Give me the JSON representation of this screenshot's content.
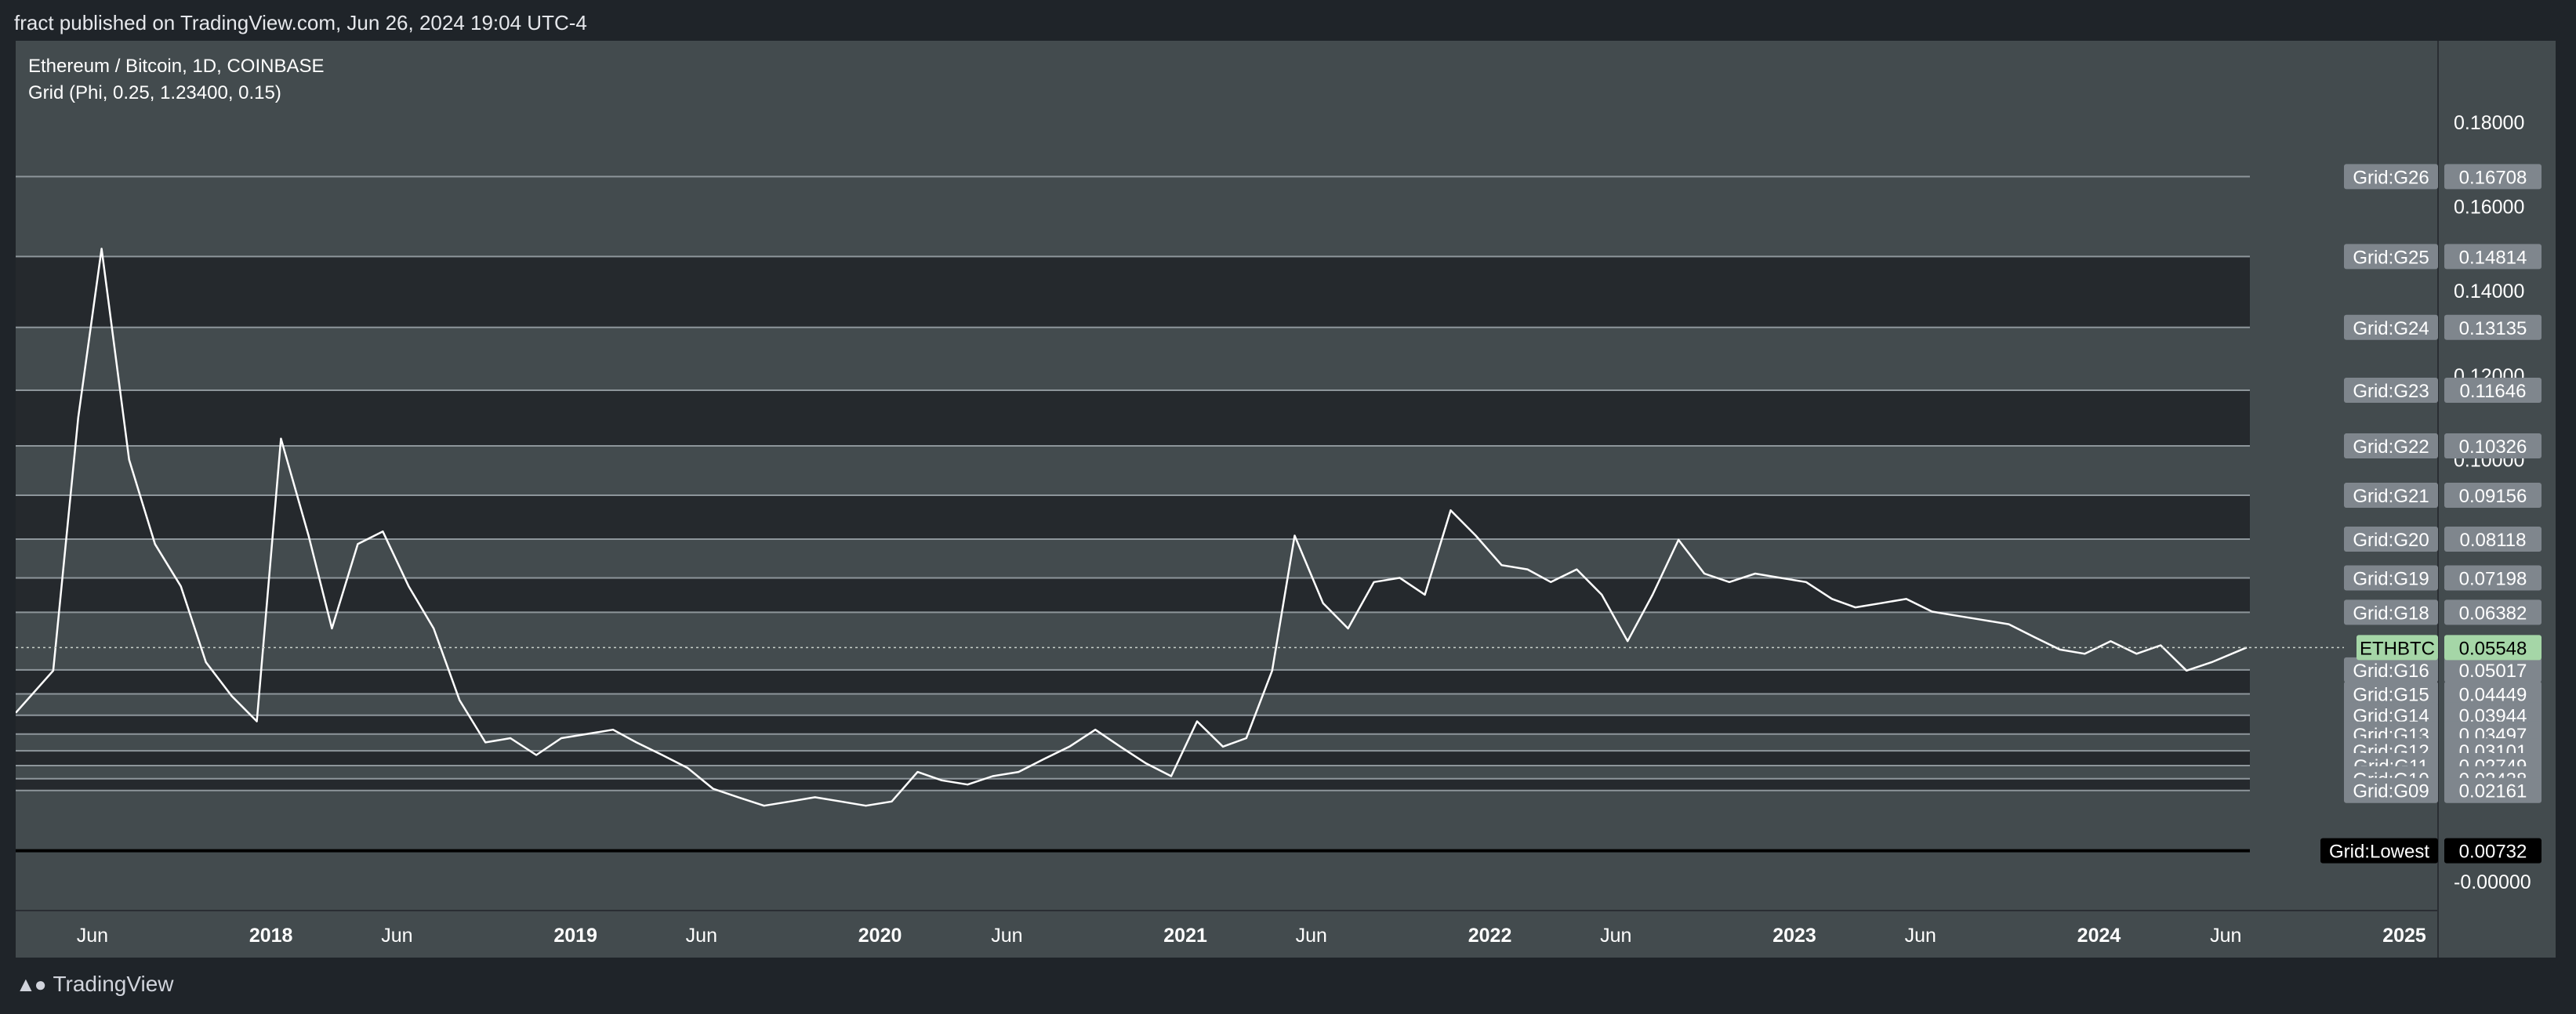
{
  "header": {
    "published": "fract published on TradingView.com, Jun 26, 2024 19:04 UTC-4"
  },
  "legend": {
    "symbol": "Ethereum / Bitcoin, 1D, COINBASE",
    "indicator": "Grid (Phi, 0.25, 1.23400, 0.15)"
  },
  "footer": {
    "brand": "TradingView",
    "logo_icon": "tradingview-logo-icon"
  },
  "chart_data": {
    "type": "line",
    "ylim": [
      -0.005,
      0.19
    ],
    "xlim": [
      "2017-03-01",
      "2025-02-01"
    ],
    "y_ticks": [
      "0.18000",
      "0.16000",
      "0.14000",
      "0.12000",
      "0.10000",
      "-0.00000"
    ],
    "y_tick_values": [
      0.18,
      0.16,
      0.14,
      0.12,
      0.1,
      0.0
    ],
    "x_ticks": [
      {
        "label": "Jun",
        "date": "2017-06-01",
        "bold": false
      },
      {
        "label": "2018",
        "date": "2018-01-01",
        "bold": true
      },
      {
        "label": "Jun",
        "date": "2018-06-01",
        "bold": false
      },
      {
        "label": "2019",
        "date": "2019-01-01",
        "bold": true
      },
      {
        "label": "Jun",
        "date": "2019-06-01",
        "bold": false
      },
      {
        "label": "2020",
        "date": "2020-01-01",
        "bold": true
      },
      {
        "label": "Jun",
        "date": "2020-06-01",
        "bold": false
      },
      {
        "label": "2021",
        "date": "2021-01-01",
        "bold": true
      },
      {
        "label": "Jun",
        "date": "2021-06-01",
        "bold": false
      },
      {
        "label": "2022",
        "date": "2022-01-01",
        "bold": true
      },
      {
        "label": "Jun",
        "date": "2022-06-01",
        "bold": false
      },
      {
        "label": "2023",
        "date": "2023-01-01",
        "bold": true
      },
      {
        "label": "Jun",
        "date": "2023-06-01",
        "bold": false
      },
      {
        "label": "2024",
        "date": "2024-01-01",
        "bold": true
      },
      {
        "label": "Jun",
        "date": "2024-06-01",
        "bold": false
      },
      {
        "label": "2025",
        "date": "2025-01-01",
        "bold": true
      }
    ],
    "series": [
      {
        "name": "ETHBTC",
        "x": [
          "2017-03-01",
          "2017-04-15",
          "2017-05-15",
          "2017-06-12",
          "2017-07-15",
          "2017-08-15",
          "2017-09-15",
          "2017-10-15",
          "2017-11-15",
          "2017-12-15",
          "2018-01-13",
          "2018-02-15",
          "2018-03-15",
          "2018-04-15",
          "2018-05-15",
          "2018-06-15",
          "2018-07-15",
          "2018-08-15",
          "2018-09-15",
          "2018-10-15",
          "2018-11-15",
          "2018-12-15",
          "2019-01-15",
          "2019-02-15",
          "2019-03-15",
          "2019-04-15",
          "2019-05-15",
          "2019-06-15",
          "2019-07-15",
          "2019-08-15",
          "2019-09-15",
          "2019-10-15",
          "2019-11-15",
          "2019-12-15",
          "2020-01-15",
          "2020-02-15",
          "2020-03-15",
          "2020-04-15",
          "2020-05-15",
          "2020-06-15",
          "2020-07-15",
          "2020-08-15",
          "2020-09-15",
          "2020-10-15",
          "2020-11-15",
          "2020-12-15",
          "2021-01-15",
          "2021-02-15",
          "2021-03-15",
          "2021-04-15",
          "2021-05-12",
          "2021-06-15",
          "2021-07-15",
          "2021-08-15",
          "2021-09-15",
          "2021-10-15",
          "2021-11-15",
          "2021-12-15",
          "2022-01-15",
          "2022-02-15",
          "2022-03-15",
          "2022-04-15",
          "2022-05-15",
          "2022-06-15",
          "2022-07-15",
          "2022-08-15",
          "2022-09-15",
          "2022-10-15",
          "2022-11-15",
          "2022-12-15",
          "2023-01-15",
          "2023-02-15",
          "2023-03-15",
          "2023-04-15",
          "2023-05-15",
          "2023-06-15",
          "2023-07-15",
          "2023-08-15",
          "2023-09-15",
          "2023-10-15",
          "2023-11-15",
          "2023-12-15",
          "2024-01-15",
          "2024-02-15",
          "2024-03-15",
          "2024-04-15",
          "2024-05-15",
          "2024-06-26"
        ],
        "y": [
          0.04,
          0.05,
          0.11,
          0.15,
          0.1,
          0.08,
          0.07,
          0.052,
          0.044,
          0.038,
          0.105,
          0.082,
          0.06,
          0.08,
          0.083,
          0.07,
          0.06,
          0.043,
          0.033,
          0.034,
          0.03,
          0.034,
          0.035,
          0.036,
          0.033,
          0.03,
          0.027,
          0.022,
          0.02,
          0.018,
          0.019,
          0.02,
          0.019,
          0.018,
          0.019,
          0.026,
          0.024,
          0.023,
          0.025,
          0.026,
          0.029,
          0.032,
          0.036,
          0.032,
          0.028,
          0.025,
          0.038,
          0.032,
          0.034,
          0.05,
          0.082,
          0.066,
          0.06,
          0.071,
          0.072,
          0.068,
          0.088,
          0.082,
          0.075,
          0.074,
          0.071,
          0.074,
          0.068,
          0.057,
          0.068,
          0.081,
          0.073,
          0.071,
          0.073,
          0.072,
          0.071,
          0.067,
          0.065,
          0.066,
          0.067,
          0.064,
          0.063,
          0.062,
          0.061,
          0.058,
          0.055,
          0.054,
          0.057,
          0.054,
          0.056,
          0.05,
          0.052,
          0.05548
        ]
      }
    ],
    "grid_levels": [
      {
        "name": "Grid:G26",
        "value": 0.16708
      },
      {
        "name": "Grid:G25",
        "value": 0.14814
      },
      {
        "name": "Grid:G24",
        "value": 0.13135
      },
      {
        "name": "Grid:G23",
        "value": 0.11646
      },
      {
        "name": "Grid:G22",
        "value": 0.10326
      },
      {
        "name": "Grid:G21",
        "value": 0.09156
      },
      {
        "name": "Grid:G20",
        "value": 0.08118
      },
      {
        "name": "Grid:G19",
        "value": 0.07198
      },
      {
        "name": "Grid:G18",
        "value": 0.06382
      },
      {
        "name": "Grid:G16",
        "value": 0.05017
      },
      {
        "name": "Grid:G15",
        "value": 0.04449
      },
      {
        "name": "Grid:G14",
        "value": 0.03944
      },
      {
        "name": "Grid:G13",
        "value": 0.03497
      },
      {
        "name": "Grid:G12",
        "value": 0.03101
      },
      {
        "name": "Grid:G11",
        "value": 0.02749
      },
      {
        "name": "Grid:G10",
        "value": 0.02438
      },
      {
        "name": "Grid:G09",
        "value": 0.02161
      },
      {
        "name": "Grid:Lowest",
        "value": 0.00732
      }
    ],
    "current_price": {
      "label": "ETHBTC",
      "value": "0.05548"
    },
    "colors": {
      "pane": "#434b4e",
      "band": "#22262a",
      "grid_line": "#8e969b",
      "price_line": "#ffffff",
      "label_bg": "#7f868d",
      "current_bg": "#a5d6a7",
      "lowest_bg": "#000000"
    }
  }
}
